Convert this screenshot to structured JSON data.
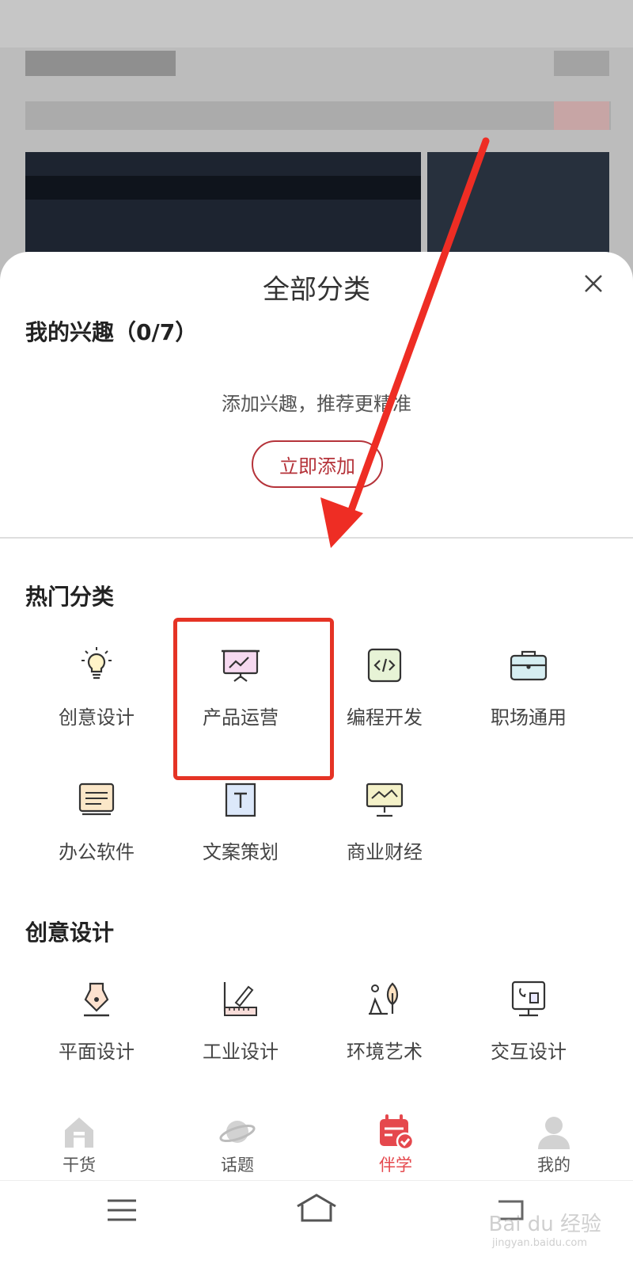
{
  "sheet": {
    "title": "全部分类"
  },
  "interests": {
    "title": "我的兴趣（0/7）",
    "empty_hint": "添加兴趣，推荐更精准",
    "add_label": "立即添加"
  },
  "hot": {
    "title": "热门分类",
    "items": [
      {
        "label": "创意设计",
        "icon": "lightbulb-icon"
      },
      {
        "label": "产品运营",
        "icon": "presentation-chart-icon"
      },
      {
        "label": "编程开发",
        "icon": "code-icon"
      },
      {
        "label": "职场通用",
        "icon": "briefcase-icon"
      },
      {
        "label": "办公软件",
        "icon": "office-doc-icon"
      },
      {
        "label": "文案策划",
        "icon": "text-doc-icon"
      },
      {
        "label": "商业财经",
        "icon": "finance-board-icon"
      }
    ]
  },
  "creative": {
    "title": "创意设计",
    "items": [
      {
        "label": "平面设计",
        "icon": "pen-nib-icon"
      },
      {
        "label": "工业设计",
        "icon": "ruler-pencil-icon"
      },
      {
        "label": "环境艺术",
        "icon": "tree-art-icon"
      },
      {
        "label": "交互设计",
        "icon": "interactive-screen-icon"
      }
    ]
  },
  "tabs": [
    {
      "label": "干货",
      "icon": "house-icon"
    },
    {
      "label": "话题",
      "icon": "planet-icon"
    },
    {
      "label": "伴学",
      "icon": "calendar-check-icon",
      "active": true
    },
    {
      "label": "我的",
      "icon": "user-icon"
    }
  ],
  "watermark": {
    "main": "Bai du 经验",
    "sub": "jingyan.baidu.com"
  },
  "colors": {
    "accent": "#e5484d",
    "highlight": "#e53325",
    "button": "#b5333a"
  }
}
